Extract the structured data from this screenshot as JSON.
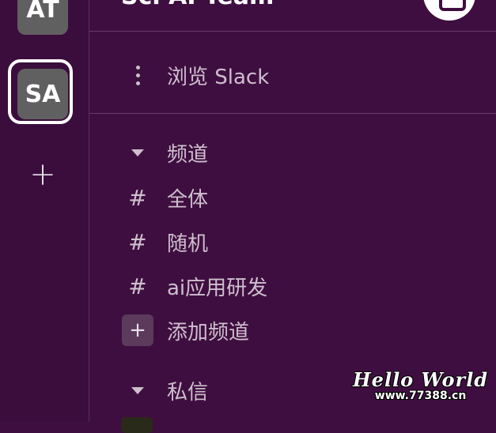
{
  "workspaces": [
    {
      "initials": "AT"
    },
    {
      "initials": "SA",
      "selected": true
    }
  ],
  "add_workspace_icon": "plus-icon",
  "team_name": "Sci AI Team",
  "compose_icon": "compose-icon",
  "browse": {
    "label": "浏览 Slack",
    "icon": "more-vertical-icon"
  },
  "channels_section": {
    "label": "频道",
    "icon": "caret-down-icon",
    "items": [
      {
        "name": "全体",
        "icon": "hash-icon"
      },
      {
        "name": "随机",
        "icon": "hash-icon"
      },
      {
        "name": "ai应用研发",
        "icon": "hash-icon"
      }
    ],
    "add_label": "添加频道"
  },
  "dm_section": {
    "label": "私信",
    "icon": "caret-down-icon"
  },
  "watermark": {
    "line1": "Hello World",
    "line2": "www.77388.cn"
  },
  "colors": {
    "sidebar_bg": "#3f0e40",
    "workspace_tile": "#616061",
    "text": "#cdbfcd"
  }
}
